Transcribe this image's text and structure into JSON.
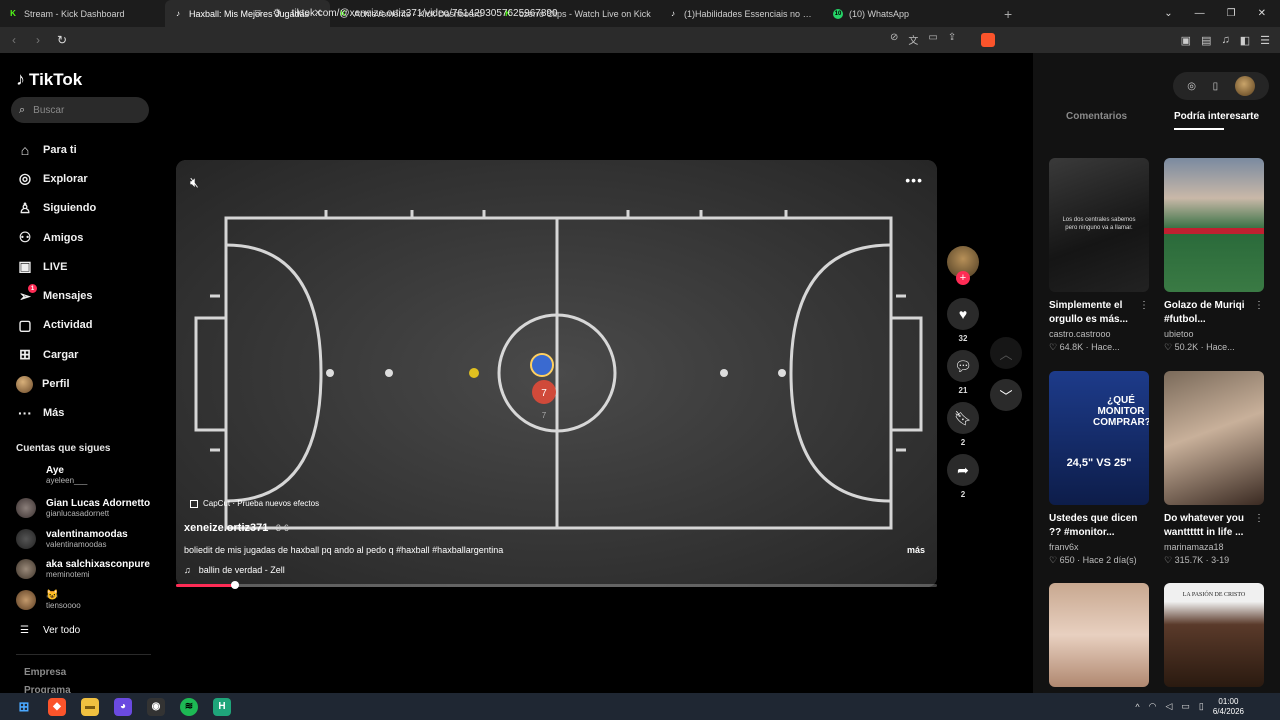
{
  "browser": {
    "tabs": [
      {
        "label": "Stream - Kick Dashboard",
        "favicon": "K",
        "type": "kick"
      },
      {
        "label": "Haxball: Mis Mejores Jugadas",
        "favicon": "♪",
        "type": "tiktok",
        "active": true
      },
      {
        "label": "Achievements - Kick Dashboard",
        "favicon": "K",
        "type": "kick"
      },
      {
        "label": "czerro Clips - Watch Live on Kick",
        "favicon": "K",
        "type": "kick"
      },
      {
        "label": "(1)Habilidades Essenciais no Futsal pa",
        "favicon": "♪",
        "type": "tiktok"
      },
      {
        "label": "(10) WhatsApp",
        "favicon": "10",
        "type": "whatsapp"
      }
    ],
    "url": "tiktok.com/@xeneize.ortiz371/video/7614293057625967890"
  },
  "sidebar": {
    "logo": "TikTok",
    "search_placeholder": "Buscar",
    "nav": [
      {
        "label": "Para ti",
        "icon": "home-icon"
      },
      {
        "label": "Explorar",
        "icon": "compass-icon"
      },
      {
        "label": "Siguiendo",
        "icon": "user-follow-icon"
      },
      {
        "label": "Amigos",
        "icon": "friends-icon"
      },
      {
        "label": "LIVE",
        "icon": "live-icon"
      },
      {
        "label": "Mensajes",
        "icon": "send-icon",
        "badge": "1"
      },
      {
        "label": "Actividad",
        "icon": "inbox-icon"
      },
      {
        "label": "Cargar",
        "icon": "upload-icon"
      },
      {
        "label": "Perfil",
        "icon": "avatar"
      },
      {
        "label": "Más",
        "icon": "more-icon"
      }
    ],
    "following_title": "Cuentas que sigues",
    "following": [
      {
        "name": "Aye",
        "user": "ayeleen___"
      },
      {
        "name": "Gian Lucas Adornetto",
        "user": "gianlucasadornett"
      },
      {
        "name": "valentinamoodas",
        "user": "valentinamoodas"
      },
      {
        "name": "aka salchixasconpure",
        "user": "meminotemi"
      },
      {
        "name": "😺",
        "user": "tiensoooo"
      }
    ],
    "see_all": "Ver todo",
    "footer": [
      "Empresa",
      "Programa"
    ]
  },
  "video": {
    "author": "xeneize.ortiz371",
    "date": "· 3-6",
    "description": "boliedit de mis jugadas de haxball pq ando al pedo q #haxball #haxballargentina",
    "more": "más",
    "music": "ballin de verdad - Zell",
    "capcut": "CapCut · Prueba nuevos efectos",
    "progress": 0.077,
    "player_numbers": [
      "7",
      "7"
    ]
  },
  "actions": {
    "likes": "32",
    "comments": "21",
    "saves": "2",
    "shares": "2"
  },
  "right_panel": {
    "tabs": {
      "comments": "Comentarios",
      "suggested": "Podría interesarte"
    },
    "cards": [
      {
        "title": "Simplemente el orgullo es más...",
        "user": "castro.castrooo",
        "meta": "64.8K · Hace...",
        "thumb_text": "Los dos centrales sabemos pero ninguno va a llamar."
      },
      {
        "title": "Golazo de Muriqi #futbol...",
        "user": "ubietoo",
        "meta": "50.2K · Hace...",
        "thumb_text": ""
      },
      {
        "title": "Ustedes que dicen ?? #monitor...",
        "user": "franv6x",
        "meta": "650 · Hace 2 día(s)",
        "thumb_text": "¿QUÉ MONITOR COMPRAR?",
        "thumb_sub": "24,5\" VS 25\""
      },
      {
        "title": "Do whatever you wantttttt in life ...",
        "user": "marinamaza18",
        "meta": "315.7K · 3-19",
        "thumb_text": ""
      },
      {
        "title": "",
        "user": "",
        "meta": "",
        "thumb_text": ""
      },
      {
        "title": "",
        "user": "",
        "meta": "",
        "thumb_text": "LA PASIÓN DE CRISTO"
      }
    ]
  },
  "taskbar": {
    "time": "01:00",
    "date": "6/4/2026"
  }
}
